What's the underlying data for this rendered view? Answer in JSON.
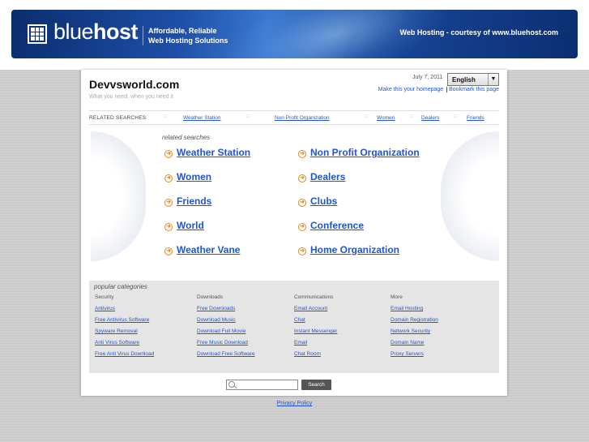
{
  "banner": {
    "brand_light": "blue",
    "brand_bold": "host",
    "tagline_line1": "Affordable, Reliable",
    "tagline_line2": "Web Hosting Solutions",
    "courtesy": "Web Hosting - courtesy of www.bluehost.com"
  },
  "header": {
    "site_title": "Devvsworld.com",
    "site_subtitle": "What you need, when you need it",
    "date": "July 7, 2011",
    "language": "English",
    "make_homepage": "Make this your homepage",
    "bookmark": "Bookmark this page"
  },
  "related_bar": {
    "label": "RELATED SEARCHES",
    "links": [
      "Weather Station",
      "Non Profit Organization",
      "Women",
      "Dealers",
      "Friends"
    ]
  },
  "related_searches": {
    "title": "related searches",
    "left": [
      "Weather Station",
      "Women",
      "Friends",
      "World",
      "Weather Vane"
    ],
    "right": [
      "Non Profit Organization",
      "Dealers",
      "Clubs",
      "Conference",
      "Home Organization"
    ]
  },
  "popular": {
    "title": "popular categories",
    "columns": [
      {
        "heading": "Security",
        "links": [
          "Antivirus",
          "Free Antivirus Software",
          "Spyware Removal",
          "Anti Virus Software",
          "Free Anti Virus Download"
        ]
      },
      {
        "heading": "Downloads",
        "links": [
          "Free Downloads",
          "Download Music",
          "Download Full Movie",
          "Free Music Download",
          "Download Free Software"
        ]
      },
      {
        "heading": "Communications",
        "links": [
          "Email Account",
          "Chat",
          "Instant Messenger",
          "Email",
          "Chat Room"
        ]
      },
      {
        "heading": "More",
        "links": [
          "Email Hosting",
          "Domain Registration",
          "Network Security",
          "Domain Name",
          "Proxy Servers"
        ]
      }
    ]
  },
  "search": {
    "value": "",
    "button": "Search"
  },
  "footer": {
    "privacy": "Privacy Policy"
  },
  "colors": {
    "banner": "#1e4fa8",
    "link": "#2255cc",
    "arrow": "#e08a1e"
  }
}
